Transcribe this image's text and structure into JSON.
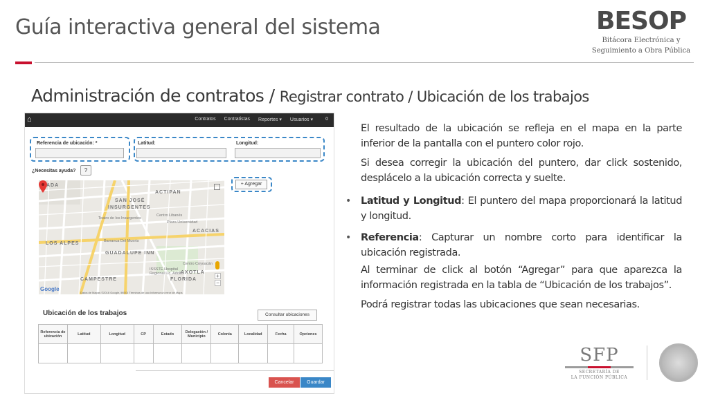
{
  "header": {
    "title": "Guía interactiva general del sistema",
    "logo": {
      "word": "BESOP",
      "line1": "Bitácora Electrónica y",
      "line2": "Seguimiento a Obra Pública"
    }
  },
  "section": {
    "main": "Administración de contratos /",
    "sub": "Registrar contrato / Ubicación de los trabajos"
  },
  "app": {
    "nav": [
      "Contratos",
      "Contratistas",
      "Reportes ▾",
      "Usuarios ▾"
    ],
    "nav_count": "0",
    "ref_label": "Referencia de ubicación: *",
    "lat_label": "Latitud:",
    "lng_label": "Longitud:",
    "help_label": "¿Necesitas ayuda?",
    "help_btn": "?",
    "agregar": "+ Agregar",
    "map_labels": [
      "ICADA",
      "ACTIPAN",
      "SAN JOSÉ",
      "INSURGENTES",
      "ACACIAS",
      "LOS ALPES",
      "GUADALUPE INN",
      "FLORIDA",
      "AXOTLA",
      "CAMPESTRE"
    ],
    "map_small_labels": [
      "Teatro de los Insurgentes",
      "Centro Libanés",
      "Plaza Universidad",
      "Barranca Del Muerto",
      "Centro Coyoacán",
      "ISSSTE Hospital Regional Lic. Adolfo"
    ],
    "map_credits": "Datos de Mapas ©2016 Google, INEGI   Términos de uso   Informar un error de Maps",
    "google": "Google",
    "table_title": "Ubicación de los trabajos",
    "consultar": "Consultar ubicaciones",
    "columns": [
      "Referencia de ubicación",
      "Latitud",
      "Longitud",
      "CP",
      "Estado",
      "Delegación / Municipio",
      "Colonia",
      "Localidad",
      "Fecha",
      "Opciones"
    ],
    "cancel": "Cancelar",
    "save": "Guardar"
  },
  "text": {
    "p1": "El resultado de la ubicación se refleja en el mapa en la parte inferior de la pantalla con el puntero color rojo.",
    "p2": "Si desea corregir la ubicación del puntero, dar click sostenido, desplácelo a la ubicación correcta y suelte.",
    "b1_bold": "Latitud y Longitud",
    "b1_rest": ": El puntero del mapa proporcionará la latitud y longitud.",
    "b2_bold": "Referencia",
    "b2_rest": ": Capturar un nombre corto para identificar la ubicación registrada.",
    "p3": "Al terminar de click al botón “Agregar” para que aparezca la información registrada en la tabla de “Ubicación de los trabajos”.",
    "p4": "Podrá registrar todas las ubicaciones que sean necesarias."
  },
  "footer_logo": {
    "word": "SFP",
    "line1": "SECRETARÍA DE",
    "line2": "LA FUNCIÓN PÚBLICA"
  },
  "colors": {
    "accent": "#c8102e",
    "highlight": "#3a87c7",
    "cancel": "#d9534f",
    "save": "#3a87c7"
  }
}
